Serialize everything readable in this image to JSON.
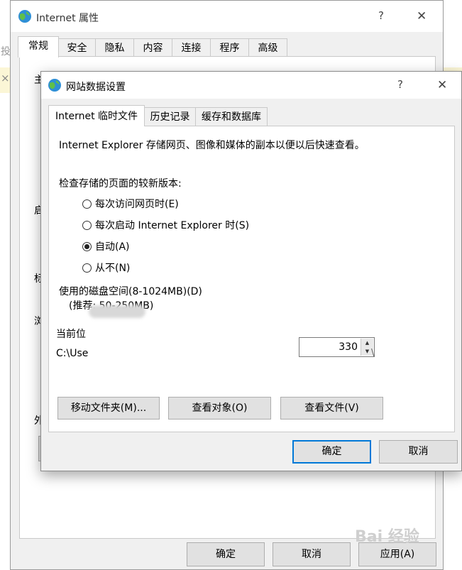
{
  "background_window": {
    "title": "Internet 属性",
    "help": "?",
    "close": "✕",
    "tabs": [
      "常规",
      "安全",
      "隐私",
      "内容",
      "连接",
      "程序",
      "高级"
    ],
    "left_edge_glyph": "投",
    "left_edge_close": "×",
    "panel_glyphs": [
      "主",
      "启",
      "标",
      "浏",
      "外"
    ],
    "buttons": {
      "ok": "确定",
      "cancel": "取消",
      "apply": "应用(A)"
    }
  },
  "dialog": {
    "title": "网站数据设置",
    "help": "?",
    "close": "✕",
    "tabs": [
      "Internet 临时文件",
      "历史记录",
      "缓存和数据库"
    ],
    "description": "Internet Explorer 存储网页、图像和媒体的副本以便以后快速查看。",
    "check_label": "检查存储的页面的较新版本:",
    "radios": [
      {
        "label": "每次访问网页时(E)",
        "checked": false
      },
      {
        "label": "每次启动 Internet Explorer 时(S)",
        "checked": false
      },
      {
        "label": "自动(A)",
        "checked": true
      },
      {
        "label": "从不(N)",
        "checked": false
      }
    ],
    "disk_label": "使用的磁盘空间(8-1024MB)(D)",
    "disk_hint": "(推荐: 50-250MB)",
    "disk_value": "330",
    "current_label": "当前位",
    "current_path": "C:\\Use",
    "current_path_tail": "\\",
    "buttons": {
      "move": "移动文件夹(M)...",
      "view_objects": "查看对象(O)",
      "view_files": "查看文件(V)",
      "ok": "确定",
      "cancel": "取消"
    }
  },
  "watermark": "Bai 经验"
}
